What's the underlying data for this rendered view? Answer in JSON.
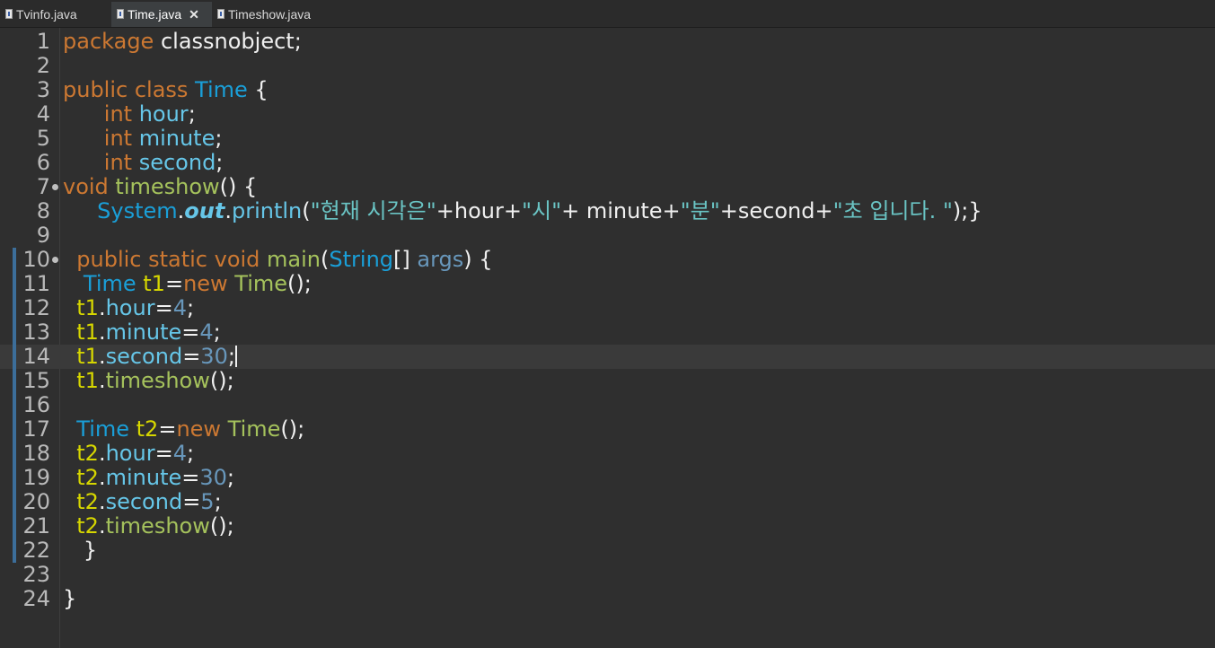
{
  "tabs": [
    {
      "label": "Tvinfo.java",
      "active": false
    },
    {
      "label": "Time.java",
      "active": true,
      "close": "✕"
    },
    {
      "label": "Timeshow.java",
      "active": false
    }
  ],
  "editor": {
    "lines": [
      {
        "n": "1",
        "t": [
          [
            "kw",
            "package"
          ],
          [
            "pl",
            " classnobject;"
          ]
        ]
      },
      {
        "n": "2",
        "t": []
      },
      {
        "n": "3",
        "t": [
          [
            "kw",
            "public class "
          ],
          [
            "tp",
            "Time"
          ],
          [
            "pl",
            " {"
          ]
        ]
      },
      {
        "n": "4",
        "t": [
          [
            "pl",
            "      "
          ],
          [
            "kw",
            "int "
          ],
          [
            "vr",
            "hour"
          ],
          [
            "pl",
            ";"
          ]
        ]
      },
      {
        "n": "5",
        "t": [
          [
            "pl",
            "      "
          ],
          [
            "kw",
            "int "
          ],
          [
            "vr",
            "minute"
          ],
          [
            "pl",
            ";"
          ]
        ]
      },
      {
        "n": "6",
        "t": [
          [
            "pl",
            "      "
          ],
          [
            "kw",
            "int "
          ],
          [
            "vr",
            "second"
          ],
          [
            "pl",
            ";"
          ]
        ]
      },
      {
        "n": "7",
        "t": [
          [
            "kw",
            "void "
          ],
          [
            "fn",
            "timeshow"
          ],
          [
            "pl",
            "() {"
          ]
        ]
      },
      {
        "n": "8",
        "t": [
          [
            "pl",
            "     "
          ],
          [
            "tp",
            "System"
          ],
          [
            "pl",
            "."
          ],
          [
            "it",
            "out"
          ],
          [
            "pl",
            "."
          ],
          [
            "vr",
            "println"
          ],
          [
            "pl",
            "("
          ],
          [
            "st",
            "\"현재 시각은\""
          ],
          [
            "pl",
            "+hour+"
          ],
          [
            "st",
            "\"시\""
          ],
          [
            "pl",
            "+ minute+"
          ],
          [
            "st",
            "\"분\""
          ],
          [
            "pl",
            "+second+"
          ],
          [
            "st",
            "\"초 입니다. \""
          ],
          [
            "pl",
            ");}"
          ]
        ]
      },
      {
        "n": "9",
        "t": []
      },
      {
        "n": "10",
        "t": [
          [
            "pl",
            "  "
          ],
          [
            "kw",
            "public static void "
          ],
          [
            "fn",
            "main"
          ],
          [
            "pl",
            "("
          ],
          [
            "tp",
            "String"
          ],
          [
            "pl",
            "[] "
          ],
          [
            "nm",
            "args"
          ],
          [
            "pl",
            ") {"
          ]
        ]
      },
      {
        "n": "11",
        "t": [
          [
            "pl",
            "   "
          ],
          [
            "tp",
            "Time "
          ],
          [
            "lv",
            "t1"
          ],
          [
            "pl",
            "="
          ],
          [
            "kw",
            "new "
          ],
          [
            "fn",
            "Time"
          ],
          [
            "pl",
            "();"
          ]
        ]
      },
      {
        "n": "12",
        "t": [
          [
            "pl",
            "  "
          ],
          [
            "lv",
            "t1"
          ],
          [
            "pl",
            "."
          ],
          [
            "vr",
            "hour"
          ],
          [
            "pl",
            "="
          ],
          [
            "nm",
            "4"
          ],
          [
            "pl",
            ";"
          ]
        ]
      },
      {
        "n": "13",
        "t": [
          [
            "pl",
            "  "
          ],
          [
            "lv",
            "t1"
          ],
          [
            "pl",
            "."
          ],
          [
            "vr",
            "minute"
          ],
          [
            "pl",
            "="
          ],
          [
            "nm",
            "4"
          ],
          [
            "pl",
            ";"
          ]
        ]
      },
      {
        "n": "14",
        "t": [
          [
            "pl",
            "  "
          ],
          [
            "lv",
            "t1"
          ],
          [
            "pl",
            "."
          ],
          [
            "vr",
            "second"
          ],
          [
            "pl",
            "="
          ],
          [
            "nm",
            "30"
          ],
          [
            "pl",
            ";"
          ]
        ]
      },
      {
        "n": "15",
        "t": [
          [
            "pl",
            "  "
          ],
          [
            "lv",
            "t1"
          ],
          [
            "pl",
            "."
          ],
          [
            "fn",
            "timeshow"
          ],
          [
            "pl",
            "();"
          ]
        ]
      },
      {
        "n": "16",
        "t": []
      },
      {
        "n": "17",
        "t": [
          [
            "pl",
            "  "
          ],
          [
            "tp",
            "Time "
          ],
          [
            "lv",
            "t2"
          ],
          [
            "pl",
            "="
          ],
          [
            "kw",
            "new "
          ],
          [
            "fn",
            "Time"
          ],
          [
            "pl",
            "();"
          ]
        ]
      },
      {
        "n": "18",
        "t": [
          [
            "pl",
            "  "
          ],
          [
            "lv",
            "t2"
          ],
          [
            "pl",
            "."
          ],
          [
            "vr",
            "hour"
          ],
          [
            "pl",
            "="
          ],
          [
            "nm",
            "4"
          ],
          [
            "pl",
            ";"
          ]
        ]
      },
      {
        "n": "19",
        "t": [
          [
            "pl",
            "  "
          ],
          [
            "lv",
            "t2"
          ],
          [
            "pl",
            "."
          ],
          [
            "vr",
            "minute"
          ],
          [
            "pl",
            "="
          ],
          [
            "nm",
            "30"
          ],
          [
            "pl",
            ";"
          ]
        ]
      },
      {
        "n": "20",
        "t": [
          [
            "pl",
            "  "
          ],
          [
            "lv",
            "t2"
          ],
          [
            "pl",
            "."
          ],
          [
            "vr",
            "second"
          ],
          [
            "pl",
            "="
          ],
          [
            "nm",
            "5"
          ],
          [
            "pl",
            ";"
          ]
        ]
      },
      {
        "n": "21",
        "t": [
          [
            "pl",
            "  "
          ],
          [
            "lv",
            "t2"
          ],
          [
            "pl",
            "."
          ],
          [
            "fn",
            "timeshow"
          ],
          [
            "pl",
            "();"
          ]
        ]
      },
      {
        "n": "22",
        "t": [
          [
            "pl",
            "   }"
          ]
        ]
      },
      {
        "n": "23",
        "t": []
      },
      {
        "n": "24",
        "t": [
          [
            "pl",
            "}"
          ]
        ]
      }
    ]
  }
}
